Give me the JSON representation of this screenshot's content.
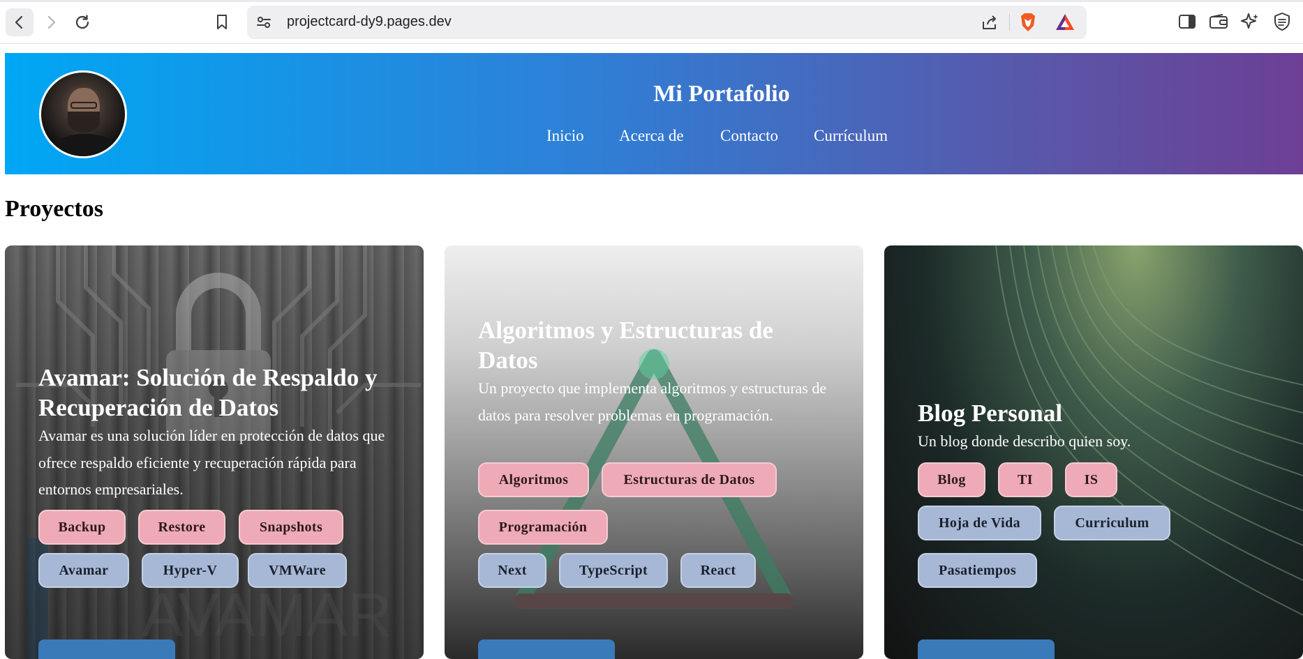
{
  "browser": {
    "url": "projectcard-dy9.pages.dev"
  },
  "header": {
    "title": "Mi Portafolio",
    "nav": [
      "Inicio",
      "Acerca de",
      "Contacto",
      "Currículum"
    ]
  },
  "section": {
    "title": "Proyectos"
  },
  "cards": [
    {
      "title": "Avamar: Solución de Respaldo y Recuperación de Datos",
      "description": "Avamar es una solución líder en protección de datos que ofrece respaldo eficiente y recuperación rápida para entornos empresariales.",
      "tags": [
        "Backup",
        "Restore",
        "Snapshots"
      ],
      "tech": [
        "Avamar",
        "Hyper-V",
        "VMWare"
      ]
    },
    {
      "title": "Algoritmos y Estructuras de Datos",
      "description": "Un proyecto que implementa algoritmos y estructuras de datos para resolver problemas en programación.",
      "tags": [
        "Algoritmos",
        "Estructuras de Datos",
        "Programación"
      ],
      "tech": [
        "Next",
        "TypeScript",
        "React"
      ]
    },
    {
      "title": "Blog Personal",
      "description": "Un blog donde describo quien soy.",
      "tags": [
        "Blog",
        "TI",
        "IS"
      ],
      "tech": [
        "Hoja de Vida",
        "Curriculum",
        "Pasatiempos"
      ]
    }
  ],
  "colors": {
    "header_gradient_start": "#00a7f4",
    "header_gradient_end": "#6c3f95",
    "tag_pink": "#eeaab6",
    "tag_blue": "#a6b8d6",
    "cta_blue": "#3a7ab9"
  },
  "icons": [
    "back-icon",
    "forward-icon",
    "reload-icon",
    "bookmark-icon",
    "site-settings-icon",
    "share-icon",
    "brave-shields-icon",
    "brave-rewards-icon",
    "sidebar-icon",
    "wallet-icon",
    "leo-ai-icon",
    "vpn-icon"
  ]
}
